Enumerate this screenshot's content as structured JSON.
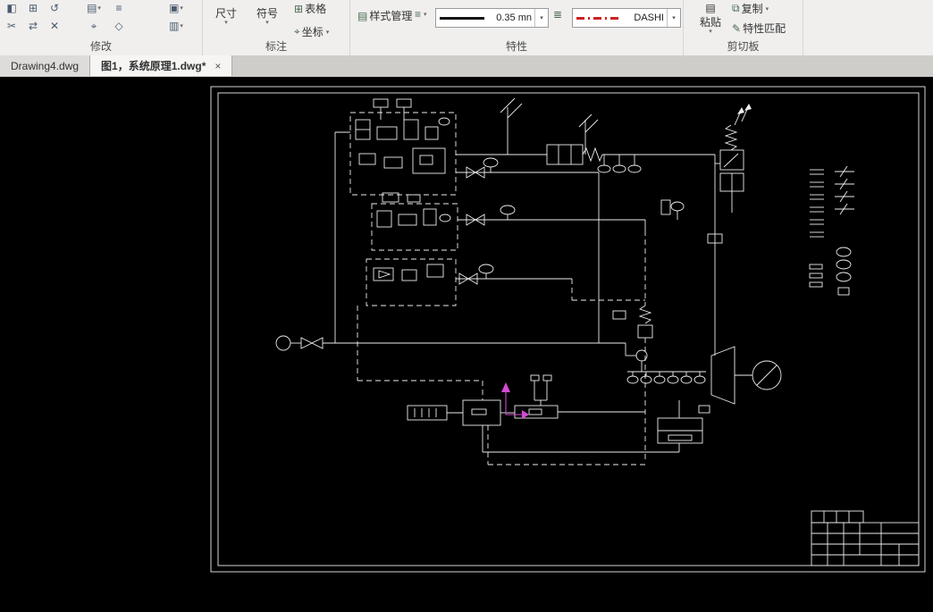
{
  "ribbon": {
    "groups": {
      "modify": {
        "label": "修改"
      },
      "annotate": {
        "label": "标注",
        "dimension": "尺寸",
        "symbol": "符号",
        "table": "表格",
        "coordinate": "坐标"
      },
      "properties": {
        "label": "特性",
        "style_manager": "样式管理",
        "lineweight": "0.35 mn",
        "linetype": "DASHI"
      },
      "clipboard": {
        "label": "剪切板",
        "paste": "粘贴",
        "copy": "复制",
        "match_properties": "特性匹配"
      }
    }
  },
  "tabs": [
    {
      "label": "Drawing4.dwg"
    },
    {
      "label": "图1，系统原理1.dwg*"
    }
  ]
}
